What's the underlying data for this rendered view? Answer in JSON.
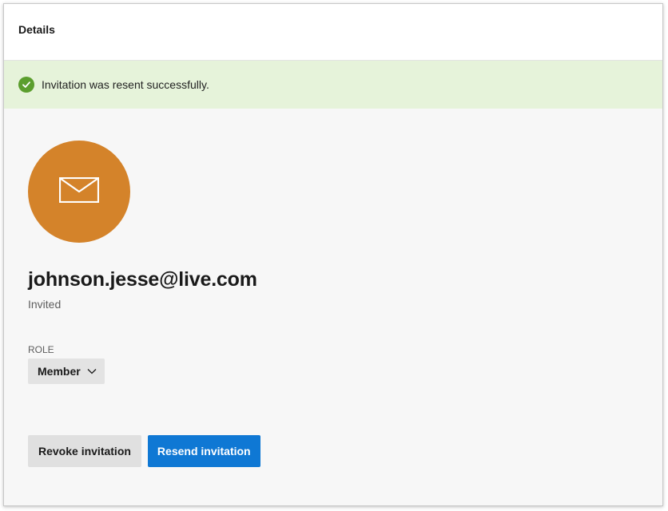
{
  "header": {
    "title": "Details"
  },
  "banner": {
    "message": "Invitation was resent successfully.",
    "icon": "check-circle-icon",
    "color": "#5b9e2d",
    "background": "#e6f3da"
  },
  "user": {
    "avatar_icon": "envelope-icon",
    "avatar_color": "#d4832a",
    "email": "johnson.jesse@live.com",
    "status": "Invited"
  },
  "role": {
    "label": "ROLE",
    "selected": "Member"
  },
  "actions": {
    "revoke_label": "Revoke invitation",
    "resend_label": "Resend invitation",
    "primary_color": "#0f78d4"
  }
}
